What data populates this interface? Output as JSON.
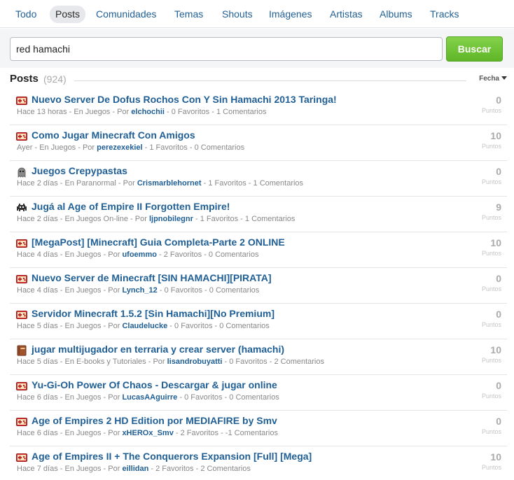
{
  "tabs": [
    {
      "label": "Todo",
      "icon": ""
    },
    {
      "label": "Posts",
      "icon": ""
    },
    {
      "label": "Comunidades",
      "icon": ""
    },
    {
      "label": "Temas",
      "icon": ""
    },
    {
      "label": "Shouts",
      "icon": ""
    },
    {
      "label": "Imágenes",
      "icon": ""
    },
    {
      "label": "Artistas",
      "icon": ""
    },
    {
      "label": "Albums",
      "icon": ""
    },
    {
      "label": "Tracks",
      "icon": ""
    }
  ],
  "active_tab": "Posts",
  "search": {
    "value": "red hamachi",
    "button_label": "Buscar"
  },
  "section": {
    "title": "Posts",
    "count": "(924)",
    "sort_label": "Fecha"
  },
  "colors": {
    "link": "#1f5f95",
    "button": "#6cc134",
    "muted": "#aaaaaa"
  },
  "points_label": "Puntos",
  "posts": [
    {
      "icon": "games-icon",
      "title": "Nuevo Server De Dofus Rochos Con Y Sin Hamachi 2013 Taringa!",
      "time": "Hace 13 horas",
      "category": "En Juegos",
      "by": "Por",
      "author": "elchochii",
      "favorites": "0 Favoritos",
      "comments": "1 Comentarios",
      "points": "0"
    },
    {
      "icon": "games-icon",
      "title": "Como Jugar Minecraft Con Amigos",
      "time": "Ayer",
      "category": "En Juegos",
      "by": "Por",
      "author": "perezexekiel",
      "favorites": "1 Favoritos",
      "comments": "0 Comentarios",
      "points": "10"
    },
    {
      "icon": "ghost-icon",
      "title": "Juegos Crepypastas",
      "time": "Hace 2 días",
      "category": "En Paranormal",
      "by": "Por",
      "author": "Crismarblehornet",
      "favorites": "1 Favoritos",
      "comments": "1 Comentarios",
      "points": "0"
    },
    {
      "icon": "space-invader-icon",
      "title": "Jugá al Age of Empire II Forgotten Empire!",
      "time": "Hace 2 días",
      "category": "En Juegos On-line",
      "by": "Por",
      "author": "ljpnobilegnr",
      "favorites": "1 Favoritos",
      "comments": "1 Comentarios",
      "points": "9"
    },
    {
      "icon": "games-icon",
      "title": "[MegaPost] [Minecraft] Guia Completa-Parte 2 ONLINE",
      "time": "Hace 4 días",
      "category": "En Juegos",
      "by": "Por",
      "author": "ufoemmo",
      "favorites": "2 Favoritos",
      "comments": "0 Comentarios",
      "points": "10"
    },
    {
      "icon": "games-icon",
      "title": "Nuevo Server de Minecraft [SIN HAMACHI][PIRATA]",
      "time": "Hace 4 días",
      "category": "En Juegos",
      "by": "Por",
      "author": "Lynch_12",
      "favorites": "0 Favoritos",
      "comments": "0 Comentarios",
      "points": "0"
    },
    {
      "icon": "games-icon",
      "title": "Servidor Minecraft 1.5.2 [Sin Hamachi][No Premium]",
      "time": "Hace 5 días",
      "category": "En Juegos",
      "by": "Por",
      "author": "Claudelucke",
      "favorites": "0 Favoritos",
      "comments": "0 Comentarios",
      "points": "0"
    },
    {
      "icon": "book-icon",
      "title": "jugar multijugador en terraria y crear server (hamachi)",
      "time": "Hace 5 días",
      "category": "En E-books y Tutoriales",
      "by": "Por",
      "author": "lisandrobuyatti",
      "favorites": "0 Favoritos",
      "comments": "2 Comentarios",
      "points": "10"
    },
    {
      "icon": "games-icon",
      "title": "Yu-Gi-Oh Power Of Chaos - Descargar & jugar online",
      "time": "Hace 6 días",
      "category": "En Juegos",
      "by": "Por",
      "author": "LucasAAguirre",
      "favorites": "0 Favoritos",
      "comments": "0 Comentarios",
      "points": "0"
    },
    {
      "icon": "games-icon",
      "title": "Age of Empires 2 HD Edition por MEDIAFIRE by Smv",
      "time": "Hace 6 días",
      "category": "En Juegos",
      "by": "Por",
      "author": "xHEROx_Smv",
      "favorites": "2 Favoritos",
      "comments": "-1 Comentarios",
      "points": "0"
    },
    {
      "icon": "games-icon",
      "title": "Age of Empires II + The Conquerors Expansion [Full] [Mega]",
      "time": "Hace 7 días",
      "category": "En Juegos",
      "by": "Por",
      "author": "eillidan",
      "favorites": "2 Favoritos",
      "comments": "2 Comentarios",
      "points": "10"
    }
  ]
}
